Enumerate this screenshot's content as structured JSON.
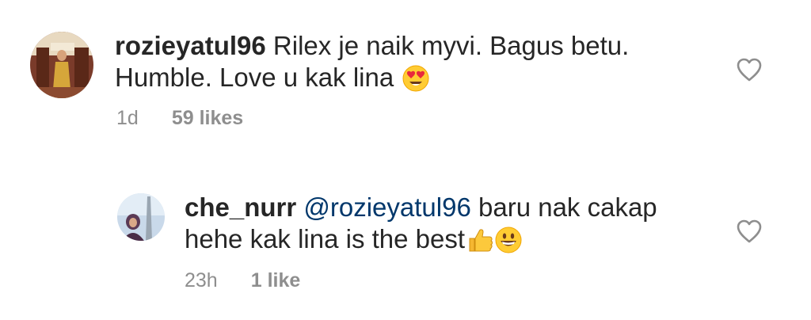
{
  "comments": [
    {
      "username": "rozieyatul96",
      "text_line1": " Rilex je naik myvi. Bagus betu.",
      "text_line2": "Humble. Love u kak lina ",
      "emoji": "heart-eyes-emoji",
      "time": "1d",
      "likes": "59 likes"
    }
  ],
  "replies": [
    {
      "username": "che_nurr",
      "mention": " @rozieyatul96",
      "text_line1": " baru nak cakap",
      "text_line2": "hehe kak lina is the best",
      "emojis": [
        "thumbs-up-emoji",
        "grinning-face-emoji"
      ],
      "time": "23h",
      "likes": "1 like"
    }
  ],
  "colors": {
    "text": "#262626",
    "meta": "#8e8e8e",
    "mention": "#00376b",
    "heart_outline": "#8e8e8e"
  }
}
